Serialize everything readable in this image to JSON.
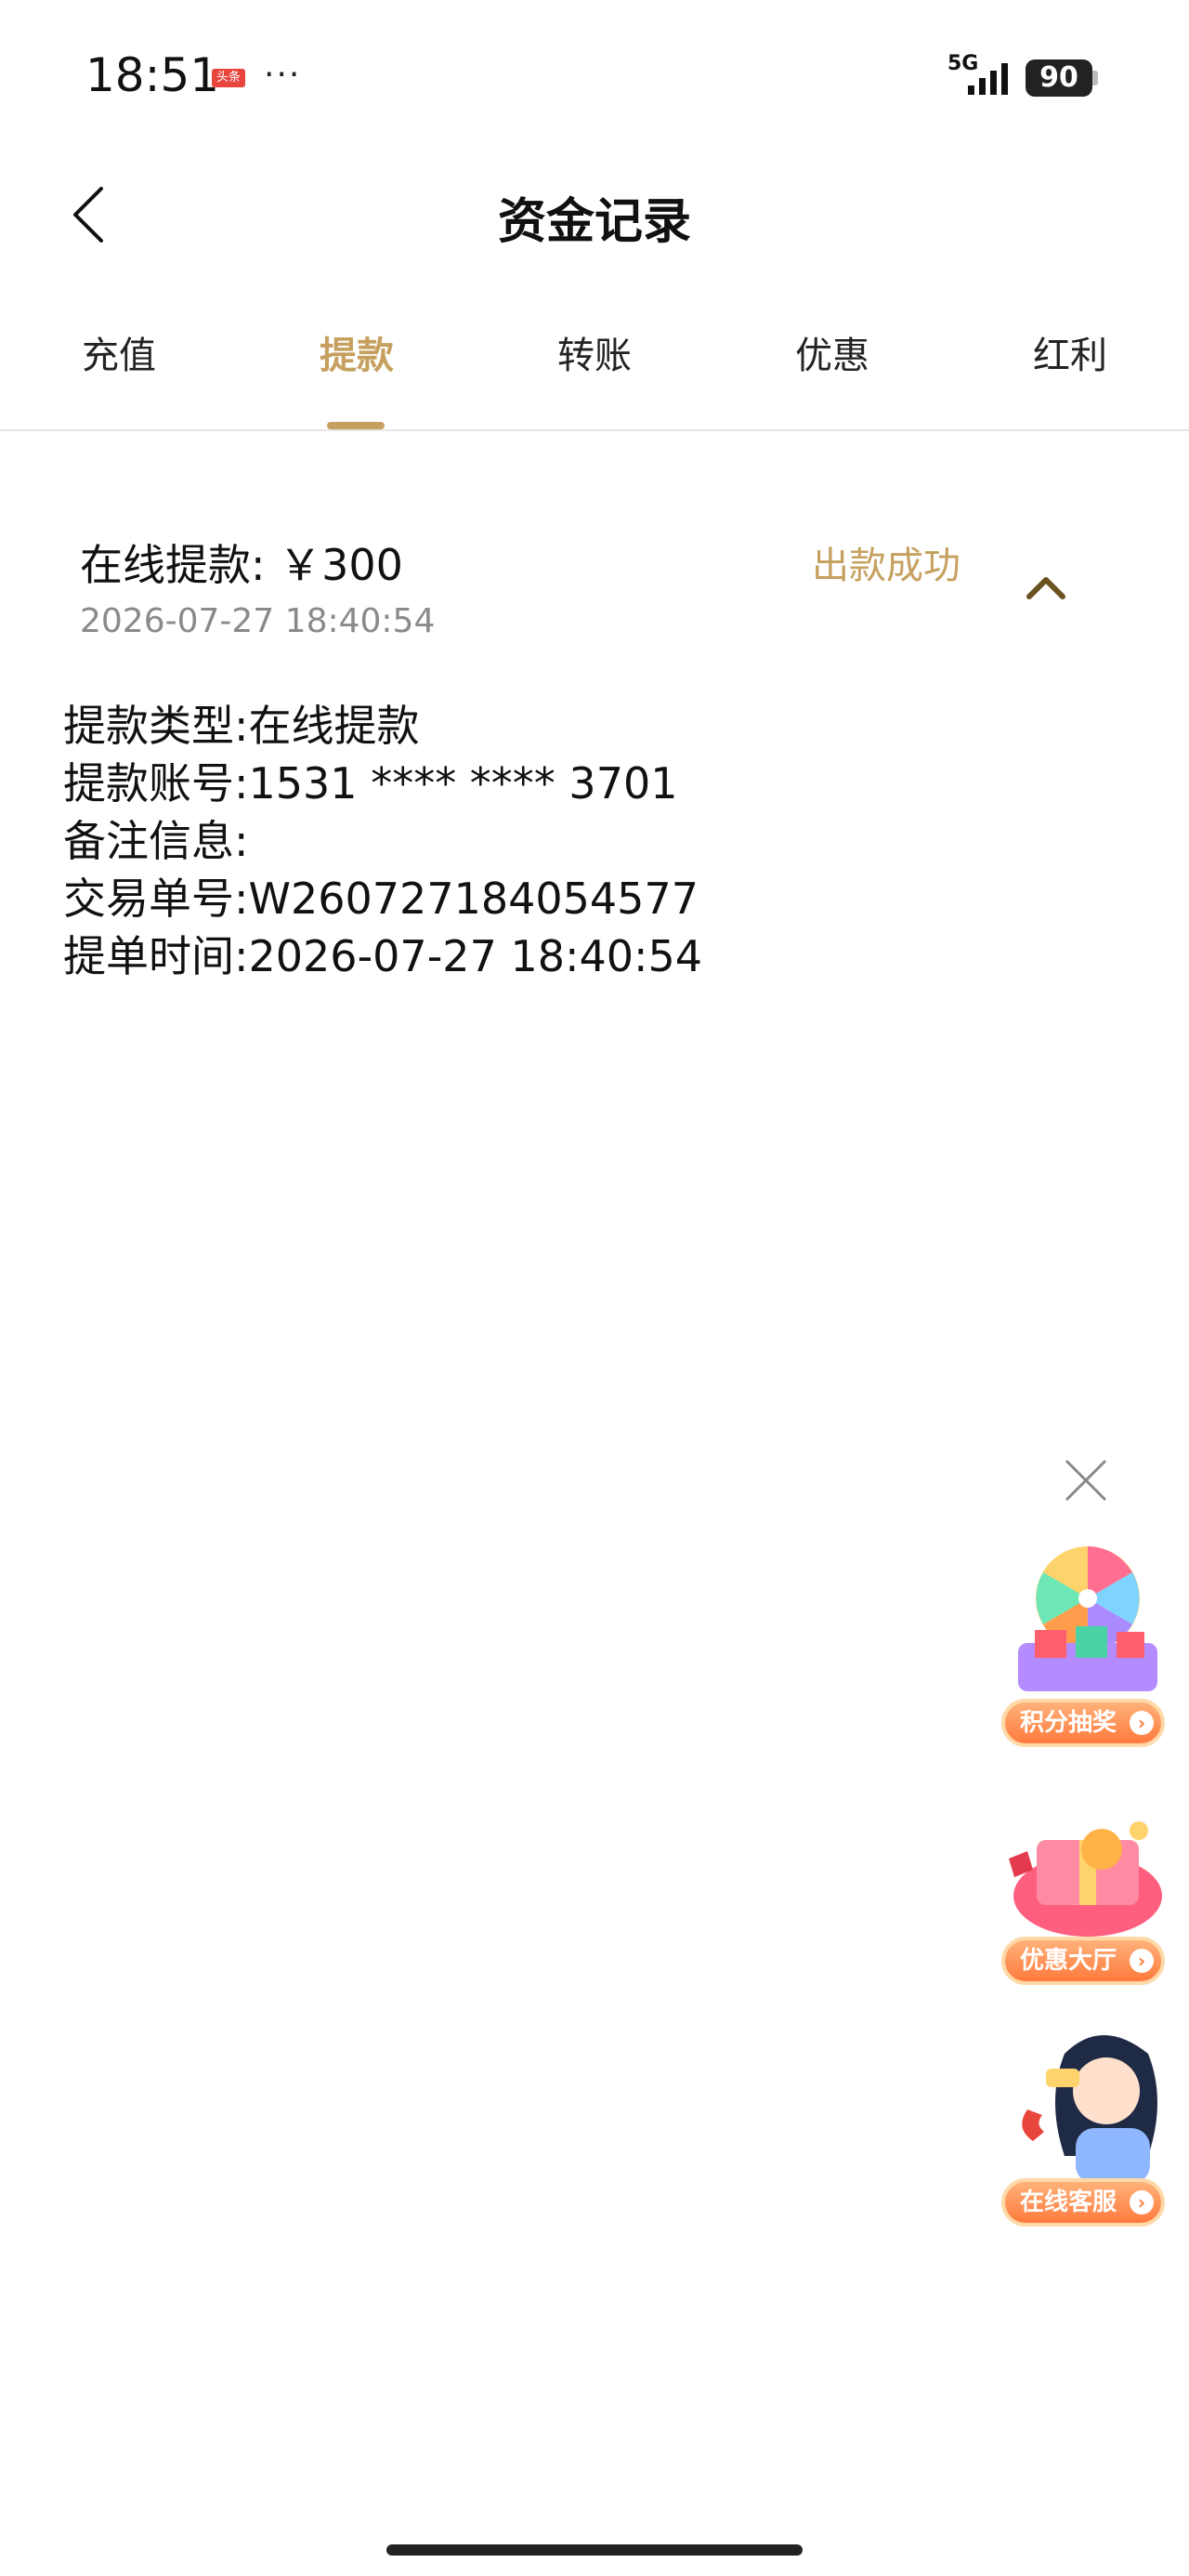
{
  "status_bar": {
    "time": "18:51",
    "badge": "头条",
    "dots": "···",
    "network": "5G",
    "battery": "90"
  },
  "header": {
    "title": "资金记录",
    "back_icon": "chevron-left-icon"
  },
  "tabs": [
    {
      "label": "充值",
      "active": false
    },
    {
      "label": "提款",
      "active": true
    },
    {
      "label": "转账",
      "active": false
    },
    {
      "label": "优惠",
      "active": false
    },
    {
      "label": "红利",
      "active": false
    }
  ],
  "record": {
    "title": "在线提款: ￥300",
    "status": "出款成功",
    "time": "2026-07-27 18:40:54",
    "details": [
      {
        "label": "提款类型:",
        "value": "在线提款"
      },
      {
        "label": "提款账号:",
        "value": "1531 **** **** 3701"
      },
      {
        "label": "备注信息:",
        "value": ""
      },
      {
        "label": "交易单号:",
        "value": "W260727184054577"
      },
      {
        "label": "提单时间:",
        "value": "2026-07-27 18:40:54"
      }
    ]
  },
  "floating": {
    "close_icon": "close-icon",
    "items": [
      {
        "label": "积分抽奖",
        "icon": "prize-wheel-icon"
      },
      {
        "label": "优惠大厅",
        "icon": "gift-box-icon"
      },
      {
        "label": "在线客服",
        "icon": "customer-service-icon"
      }
    ]
  },
  "colors": {
    "accent": "#c6a05f",
    "promo_pill": "#ff7a3d"
  }
}
